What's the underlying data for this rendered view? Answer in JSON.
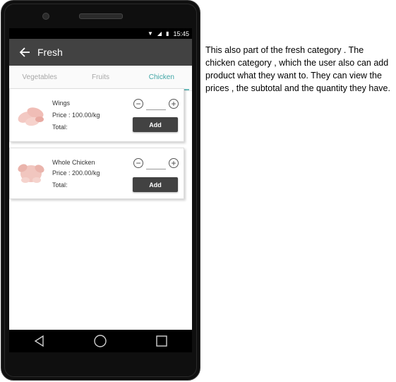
{
  "status_bar": {
    "time": "15:45"
  },
  "app_bar": {
    "title": "Fresh"
  },
  "tabs": [
    {
      "label": "Vegetables",
      "active": false
    },
    {
      "label": "Fruits",
      "active": false
    },
    {
      "label": "Chicken",
      "active": true
    }
  ],
  "products": [
    {
      "name": "Wings",
      "price": "Price : 100.00/kg",
      "total": "Total:",
      "add_label": "Add"
    },
    {
      "name": "Whole Chicken",
      "price": "Price : 200.00/kg",
      "total": "Total:",
      "add_label": "Add"
    }
  ],
  "stepper": {
    "minus": "−",
    "plus": "+"
  },
  "description": "This also part of the fresh category . The chicken category , which the user also can add product what they want to. They can view the prices , the subtotal and the quantity they have.",
  "colors": {
    "app_bar": "#424242",
    "tab_active": "#41a6a6",
    "button": "#424242"
  },
  "icons": [
    "wifi-icon",
    "signal-icon",
    "battery-icon",
    "back-arrow-icon",
    "nav-back-icon",
    "nav-home-icon",
    "nav-recents-icon"
  ]
}
